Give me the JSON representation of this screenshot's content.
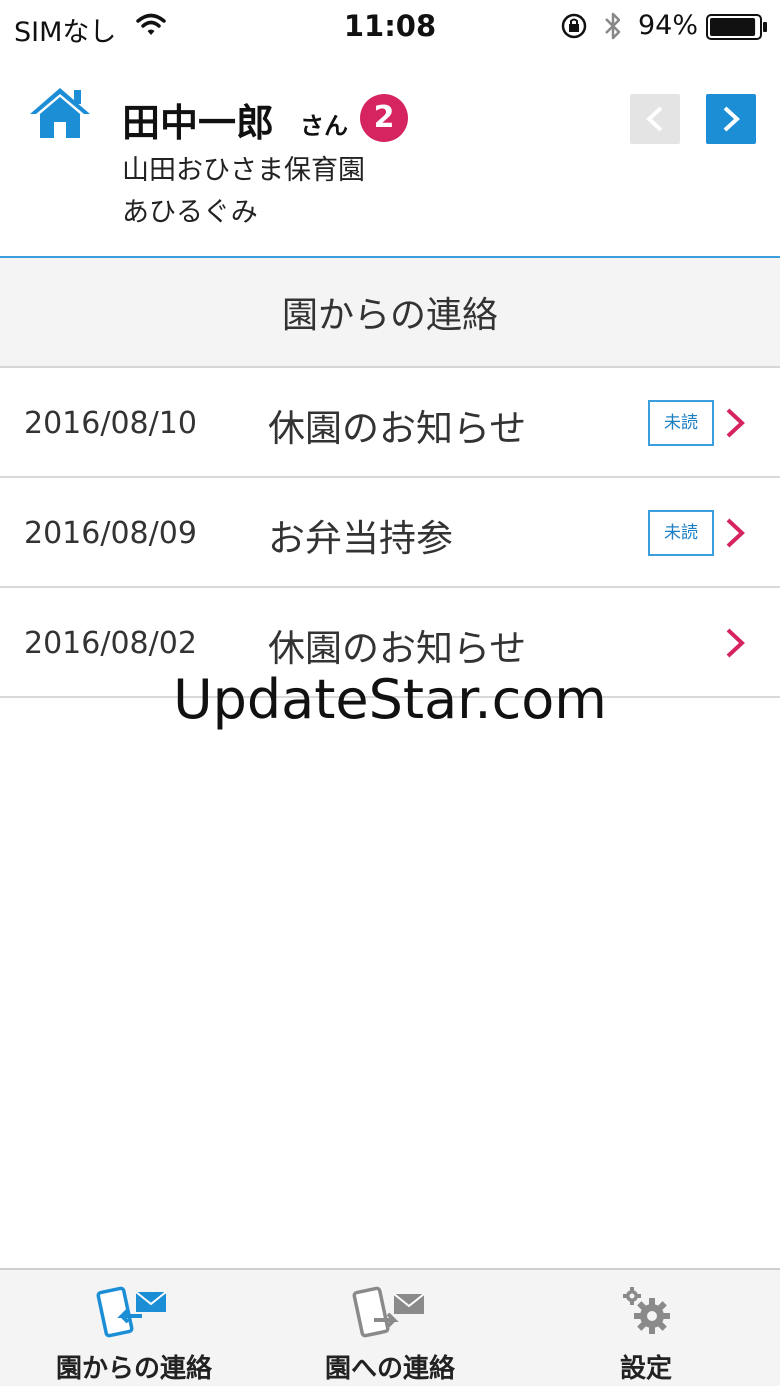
{
  "status_bar": {
    "carrier": "SIMなし",
    "time": "11:08",
    "battery": "94%",
    "battery_level": 0.94
  },
  "header": {
    "child_name": "田中一郎",
    "honorific": "さん",
    "badge_count": "2",
    "school": "山田おひさま保育園",
    "class": "あひるぐみ"
  },
  "section": {
    "title": "園からの連絡"
  },
  "messages": [
    {
      "date": "2016/08/10",
      "title": "休園のお知らせ",
      "badge": "未読"
    },
    {
      "date": "2016/08/09",
      "title": "お弁当持参",
      "badge": "未読"
    },
    {
      "date": "2016/08/02",
      "title": "休園のお知らせ",
      "badge": ""
    }
  ],
  "watermark": "UpdateStar.com",
  "tabs": [
    {
      "label": "園からの連絡",
      "icon": "inbox-message-icon"
    },
    {
      "label": "園への連絡",
      "icon": "send-message-icon"
    },
    {
      "label": "設定",
      "icon": "gear-icon"
    }
  ],
  "colors": {
    "accent_blue": "#1c8ed6",
    "badge_pink": "#d5245f",
    "chevron_pink": "#d5245f",
    "divider": "#d9d9d9"
  }
}
